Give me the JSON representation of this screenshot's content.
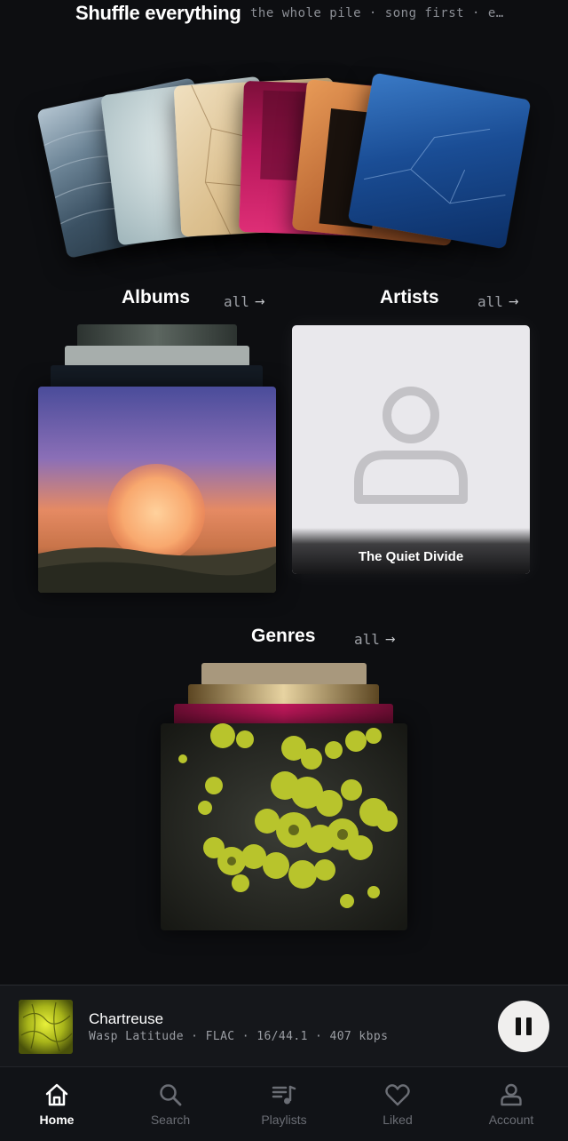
{
  "shuffle": {
    "title": "Shuffle everything",
    "subtitle": "the whole pile · song first · e…"
  },
  "fan_cards": [
    {
      "name": "ice-water",
      "colors": [
        "#9fb2c2",
        "#4c6577",
        "#2a3b48"
      ]
    },
    {
      "name": "sea-foam",
      "colors": [
        "#e2e9ea",
        "#b9cbcf",
        "#8fa8ad"
      ]
    },
    {
      "name": "cracked-earth",
      "colors": [
        "#ead7b3",
        "#d9bb8a",
        "#c7a575"
      ]
    },
    {
      "name": "crimson-room",
      "colors": [
        "#c21f62",
        "#8b1242",
        "#5c0c2c"
      ]
    },
    {
      "name": "rust-door",
      "colors": [
        "#d88343",
        "#a0582a",
        "#2b1a12"
      ]
    },
    {
      "name": "deep-blue-ice",
      "colors": [
        "#2a66b4",
        "#14407f",
        "#0b2a5b"
      ]
    }
  ],
  "albums": {
    "title": "Albums",
    "link": "all"
  },
  "artists": {
    "title": "Artists",
    "link": "all",
    "featured_name": "The Quiet Divide"
  },
  "genres": {
    "title": "Genres",
    "link": "all"
  },
  "now_playing": {
    "title": "Chartreuse",
    "meta": "Wasp Latitude · FLAC · 16/44.1 · 407 kbps",
    "state": "playing"
  },
  "nav": {
    "items": [
      {
        "label": "Home",
        "icon": "home-icon",
        "active": true
      },
      {
        "label": "Search",
        "icon": "search-icon",
        "active": false
      },
      {
        "label": "Playlists",
        "icon": "playlist-icon",
        "active": false
      },
      {
        "label": "Liked",
        "icon": "heart-icon",
        "active": false
      },
      {
        "label": "Account",
        "icon": "user-icon",
        "active": false
      }
    ]
  },
  "colors": {
    "background": "#0d0e11",
    "muted_text": "#8c8f96",
    "nav_active": "#ffffff",
    "nav_inactive": "#6b6e75"
  }
}
